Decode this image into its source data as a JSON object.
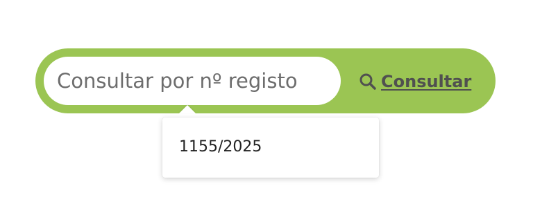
{
  "search": {
    "placeholder": "Consultar por nº registo",
    "button_label": "Consultar",
    "button_icon": "search-icon"
  },
  "suggestions": {
    "items": [
      "1155/2025"
    ]
  },
  "colors": {
    "accent": "#9bc553",
    "button_text": "#505050",
    "placeholder": "#6d6d6d"
  }
}
